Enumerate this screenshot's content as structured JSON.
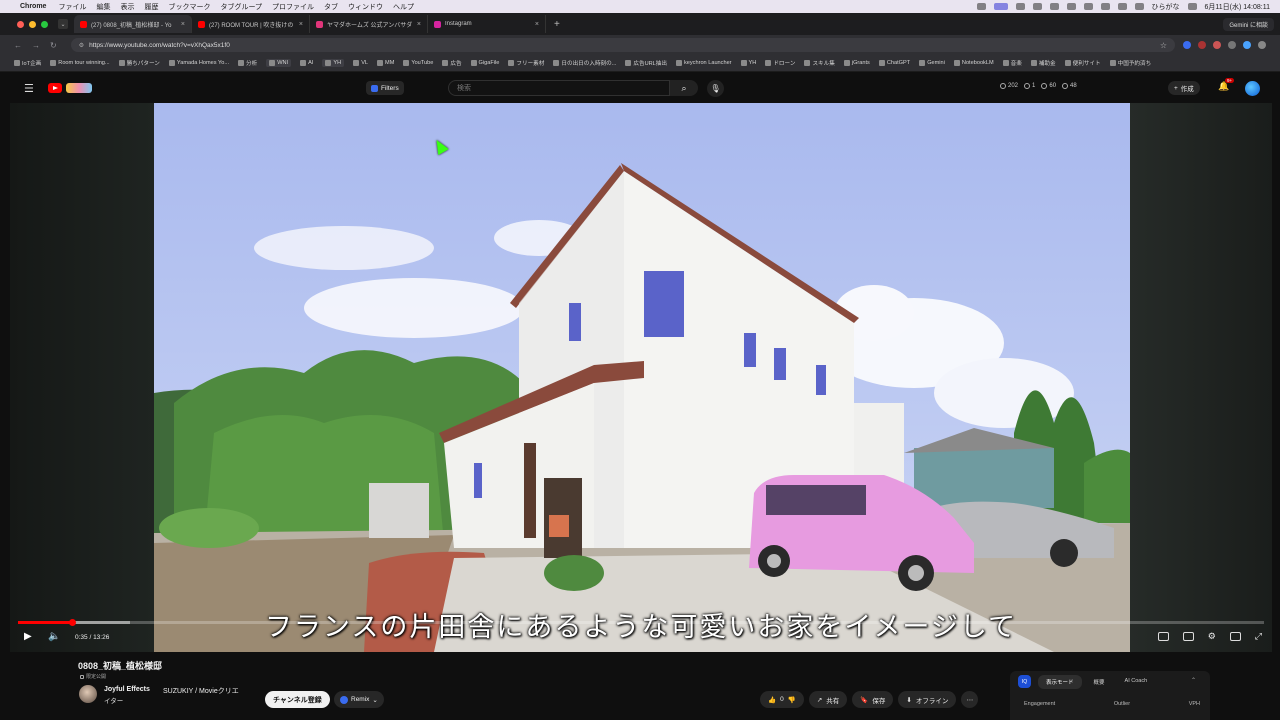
{
  "menubar": {
    "app": "Chrome",
    "items": [
      "ファイル",
      "編集",
      "表示",
      "履歴",
      "ブックマーク",
      "タブグループ",
      "プロファイル",
      "タブ",
      "ウィンドウ",
      "ヘルプ"
    ],
    "input_method": "ひらがな",
    "clock": "6月11日(水) 14:08:11"
  },
  "tabs": [
    {
      "title": "(27) 0808_初稿_植松様邸 - Yo",
      "active": true,
      "color": "#ff0000"
    },
    {
      "title": "(27) ROOM TOUR | 吹き抜けの",
      "active": false,
      "color": "#ff0000"
    },
    {
      "title": "ヤマダホームズ 公式アンバサダ",
      "active": false,
      "color": "#e0357a"
    },
    {
      "title": "Instagram",
      "active": false,
      "color": "#d6249f"
    }
  ],
  "gemini_tab": "Gemini に相談",
  "address": {
    "url": "https://www.youtube.com/watch?v=vXhQax5x1f0"
  },
  "bookmarks": [
    {
      "label": "IoT企画",
      "chip": false
    },
    {
      "label": "Room tour winning...",
      "chip": false
    },
    {
      "label": "勝ちパターン",
      "chip": false
    },
    {
      "label": "Yamada Homes Yo...",
      "chip": false
    },
    {
      "label": "分析",
      "chip": false
    },
    {
      "label": "WNI",
      "chip": true
    },
    {
      "label": "AI",
      "chip": false
    },
    {
      "label": "YH",
      "chip": true
    },
    {
      "label": "VL",
      "chip": false
    },
    {
      "label": "MM",
      "chip": false
    },
    {
      "label": "YouTube",
      "chip": false
    },
    {
      "label": "広告",
      "chip": false
    },
    {
      "label": "GigaFile",
      "chip": false
    },
    {
      "label": "フリー素材",
      "chip": false
    },
    {
      "label": "日の出日の入時刻の...",
      "chip": false
    },
    {
      "label": "広告URL抽出",
      "chip": false
    },
    {
      "label": "keychron Launcher",
      "chip": false
    },
    {
      "label": "YH",
      "chip": false
    },
    {
      "label": "ドローン",
      "chip": false
    },
    {
      "label": "スキル集",
      "chip": false
    },
    {
      "label": "jGrants",
      "chip": false
    },
    {
      "label": "ChatGPT",
      "chip": false
    },
    {
      "label": "Gemini",
      "chip": false
    },
    {
      "label": "NotebookLM",
      "chip": false
    },
    {
      "label": "音楽",
      "chip": false
    },
    {
      "label": "補助金",
      "chip": false
    },
    {
      "label": "便利サイト",
      "chip": false
    },
    {
      "label": "中国予約済ち",
      "chip": false
    }
  ],
  "yt": {
    "filters_label": "Filters",
    "search_placeholder": "検索",
    "stats": [
      "202",
      "1",
      "60",
      "48"
    ],
    "create_label": "作成",
    "notification_count": "9+"
  },
  "player": {
    "subtitle": "フランスの片田舎にあるような可愛いお家をイメージして",
    "current_time": "0:35",
    "duration": "13:26",
    "progress": 0.043,
    "buffered": 0.09,
    "time_display": "0:35 / 13:26"
  },
  "video": {
    "title": "0808_初稿_植松様邸",
    "privacy": "限定公開",
    "channel": "Joyful Effects",
    "collaborator": "SUZUKIY / Movieクリエ",
    "collaborator_cont": "イター",
    "subscribe_label": "チャンネル登録",
    "remix_label": "Remix",
    "like_count": "0",
    "share_label": "共有",
    "save_label": "保存",
    "offline_label": "オフライン"
  },
  "ext_panel": {
    "logo": "IQ",
    "tabs": [
      "表示モード",
      "概要",
      "AI Coach"
    ],
    "columns": [
      "Engagement",
      "Outlier",
      "VPH"
    ]
  },
  "colors": {
    "accent_red": "#ff0000",
    "sky": "#b9c9f2",
    "car_pink": "#e79be0"
  }
}
